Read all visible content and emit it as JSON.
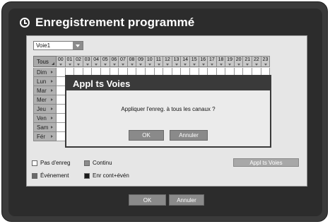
{
  "title": "Enregistrement programmé",
  "channel_select": {
    "value": "Voie1"
  },
  "grid": {
    "all_label": "Tous",
    "hours": [
      "00",
      "01",
      "02",
      "03",
      "04",
      "05",
      "06",
      "07",
      "08",
      "09",
      "10",
      "11",
      "12",
      "13",
      "14",
      "15",
      "16",
      "17",
      "18",
      "19",
      "20",
      "21",
      "22",
      "23"
    ],
    "days": [
      "Dim",
      "Lun",
      "Mar",
      "Mer",
      "Jeu",
      "Ven",
      "Sam",
      "Fér"
    ]
  },
  "legend": {
    "none": "Pas d'enreg",
    "continuous": "Continu",
    "event": "Événement",
    "cont_event": "Enr cont+évén"
  },
  "apply_all_button": "Appl ts Voies",
  "footer": {
    "ok": "OK",
    "cancel": "Annuler"
  },
  "dialog": {
    "title": "Appl ts Voies",
    "message": "Appliquer l'enreg. à tous les canaux ?",
    "ok": "OK",
    "cancel": "Annuler"
  },
  "colors": {
    "none": "#ffffff",
    "continuous": "#8c8c8c",
    "event": "#6a6a6a",
    "cont_event": "#1a1a1a"
  }
}
